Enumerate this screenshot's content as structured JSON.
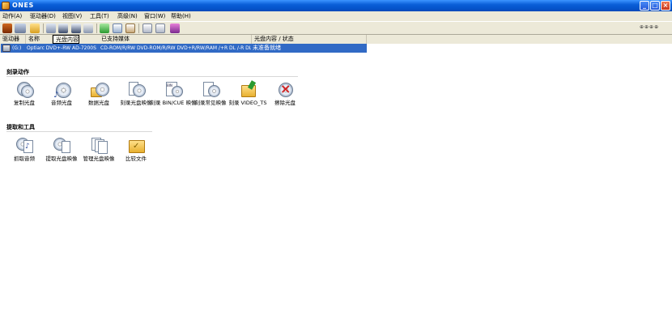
{
  "window": {
    "title": "ONES"
  },
  "menu": [
    {
      "label": "动作(A)"
    },
    {
      "label": "驱动器(D)"
    },
    {
      "label": "视图(V)"
    },
    {
      "label": "工具(T)"
    },
    {
      "label": "高级(N)"
    },
    {
      "label": "窗口(W)"
    },
    {
      "label": "帮助(H)"
    }
  ],
  "toolbar": {
    "right_label": "⊕⊕⊕⊕"
  },
  "drivelist": {
    "headers": {
      "drive": "驱动器",
      "name": "名称",
      "disc_content": "光盘内容",
      "supported_media": "已支持媒体",
      "status": "光盘内容 / 状态"
    },
    "rows": [
      {
        "drive": "(G:)",
        "name": "Optiarc DVD+-RW AD-7200S",
        "media": "CD-ROM/R/RW DVD-ROM/R/RW DVD+R/RW/RAM /+R DL /-R DL",
        "status": "未准备就绪"
      }
    ]
  },
  "sections": {
    "burn": {
      "title": "刻录动作",
      "items": [
        {
          "label": "复制光盘",
          "icon": "copy-disc-icon"
        },
        {
          "label": "音频光盘",
          "icon": "audio-disc-icon"
        },
        {
          "label": "数据光盘",
          "icon": "data-disc-icon"
        },
        {
          "label": "刻录光盘映像",
          "icon": "burn-image-icon"
        },
        {
          "label": "刻录 BIN/CUE 映像",
          "icon": "burn-bin-cue-icon"
        },
        {
          "label": "刻录常见映像",
          "icon": "burn-common-image-icon"
        },
        {
          "label": "刻录 VIDEO_TS",
          "icon": "burn-video-ts-icon"
        },
        {
          "label": "擦除光盘",
          "icon": "erase-disc-icon"
        }
      ]
    },
    "extract": {
      "title": "提取和工具",
      "items": [
        {
          "label": "抓取音频",
          "icon": "rip-audio-icon"
        },
        {
          "label": "提取光盘映像",
          "icon": "extract-image-icon"
        },
        {
          "label": "管理光盘映像",
          "icon": "manage-images-icon"
        },
        {
          "label": "比较文件",
          "icon": "compare-files-icon"
        }
      ]
    }
  },
  "colors": {
    "titlebar": "#0a5fd8",
    "selection": "#316ac5",
    "chrome": "#ece9d8"
  }
}
